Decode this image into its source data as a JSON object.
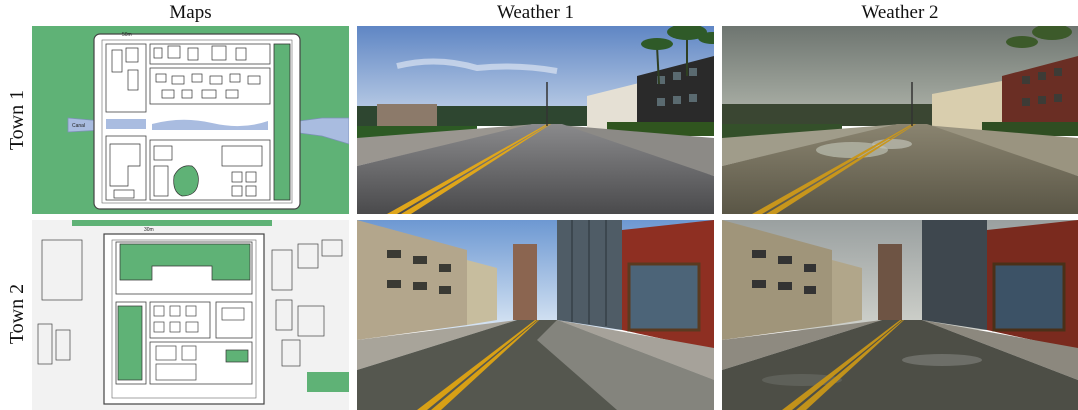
{
  "columns": [
    "Maps",
    "Weather 1",
    "Weather 2"
  ],
  "rows": [
    "Town 1",
    "Town 2"
  ],
  "panels": [
    {
      "row": "Town 1",
      "column": "Maps",
      "content": "top-down street map with green park areas and blue river"
    },
    {
      "row": "Town 1",
      "column": "Weather 1",
      "content": "clear-day street view with double yellow center line, palm trees and apartment buildings"
    },
    {
      "row": "Town 1",
      "column": "Weather 2",
      "content": "overcast wet street view with puddles, same street as Weather 1"
    },
    {
      "row": "Town 2",
      "column": "Maps",
      "content": "top-down street map with green park blocks"
    },
    {
      "row": "Town 2",
      "column": "Weather 1",
      "content": "clear-day street view with tall buildings and red brick corner shop"
    },
    {
      "row": "Town 2",
      "column": "Weather 2",
      "content": "overcast wet street view, same street as Weather 1"
    }
  ],
  "map_labels": {
    "town1_scale": "50m",
    "town1_river": "Canal",
    "town2_scale": "30m"
  },
  "colors": {
    "park_green": "#5fb276",
    "river_blue": "#a9bce0",
    "road_yellow": "#e0a61a"
  }
}
